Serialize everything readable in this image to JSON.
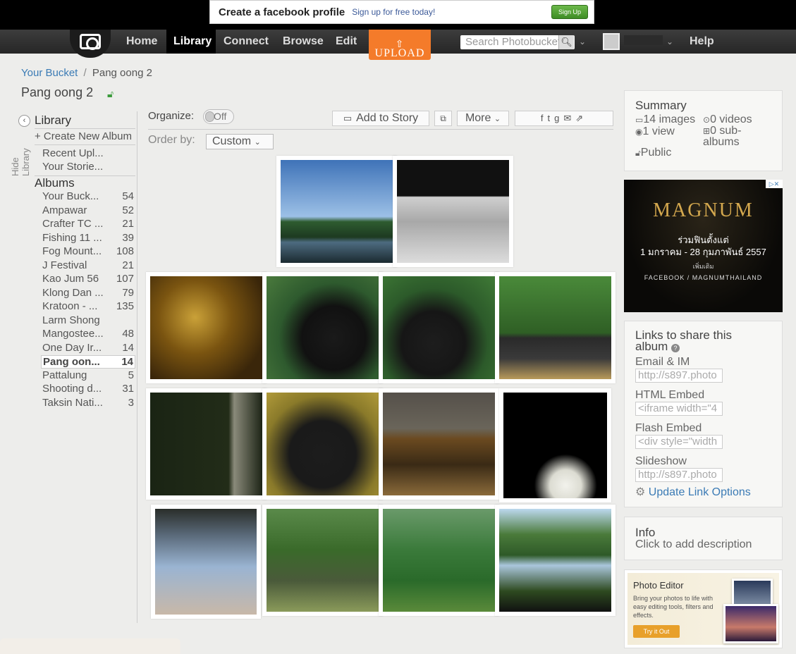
{
  "fb_ad": {
    "title": "Create a facebook profile",
    "subtitle": "Sign up for free today!",
    "button": "Sign Up"
  },
  "nav": {
    "items": [
      "Home",
      "Library",
      "Connect",
      "Browse",
      "Edit"
    ],
    "upload": "UPLOAD",
    "search_placeholder": "Search Photobucket",
    "help": "Help"
  },
  "breadcrumb": {
    "root": "Your Bucket",
    "separator": "/",
    "current": "Pang oong 2"
  },
  "album_title": "Pang oong 2",
  "sidebar": {
    "hide_library": "Hide Library",
    "library": "Library",
    "create_album": "+ Create New Album",
    "recent_uploads": "Recent Upl...",
    "your_stories": "Your Storie...",
    "albums_heading": "Albums",
    "albums": [
      {
        "name": "Your Buck...",
        "count": "54"
      },
      {
        "name": "Ampawar",
        "count": "52"
      },
      {
        "name": "Crafter TC ...",
        "count": "21"
      },
      {
        "name": "Fishing 11 ...",
        "count": "39"
      },
      {
        "name": "Fog Mount...",
        "count": "108"
      },
      {
        "name": "J Festival",
        "count": "21"
      },
      {
        "name": "Kao Jum 56",
        "count": "107"
      },
      {
        "name": "Klong Dan ...",
        "count": "79"
      },
      {
        "name": "Kratoon - ...",
        "count": "135"
      },
      {
        "name": "Larm Shong",
        "count": ""
      },
      {
        "name": "Mangostee...",
        "count": "48"
      },
      {
        "name": "One Day Ir...",
        "count": "14"
      },
      {
        "name": "Pang oon...",
        "count": "14"
      },
      {
        "name": "Pattalung",
        "count": "5"
      },
      {
        "name": "Shooting d...",
        "count": "31"
      },
      {
        "name": "Taksin Nati...",
        "count": "3"
      }
    ]
  },
  "toolbar": {
    "organize": "Organize:",
    "toggle": "Off",
    "add_to_story": "Add to Story",
    "more": "More",
    "order_by": "Order by:",
    "order_value": "Custom"
  },
  "summary": {
    "title": "Summary",
    "images": "14 images",
    "videos": "0 videos",
    "views": "1 view",
    "sub_albums_1": "0 sub-",
    "sub_albums_2": "albums",
    "privacy": "Public"
  },
  "magnum_ad": {
    "brand": "MAGNUM",
    "line1": "ร่วมฟินตั้งแต่",
    "line2": "1 มกราคม - 28 กุมภาพันธ์ 2557",
    "line3": "เพิ่มเติม",
    "line4": "FACEBOOK / MAGNUMTHAILAND"
  },
  "links": {
    "title_1": "Links to share this",
    "title_2": "album",
    "email_label": "Email & IM",
    "email_value": "http://s897.photo",
    "html_label": "HTML Embed",
    "html_value": "<iframe width=\"4",
    "flash_label": "Flash Embed",
    "flash_value": "<div style=\"width",
    "slideshow_label": "Slideshow",
    "slideshow_value": "http://s897.photo",
    "update": "Update Link Options"
  },
  "info": {
    "title": "Info",
    "placeholder": "Click to add description"
  },
  "editor_ad": {
    "title": "Photo Editor",
    "desc": "Bring your photos to life with easy editing tools, filters and effects.",
    "button": "Try it Out"
  },
  "colors": {
    "accent": "#f47b2a",
    "link": "#3b7bb5",
    "nav_bg": "#2b2b2b"
  }
}
